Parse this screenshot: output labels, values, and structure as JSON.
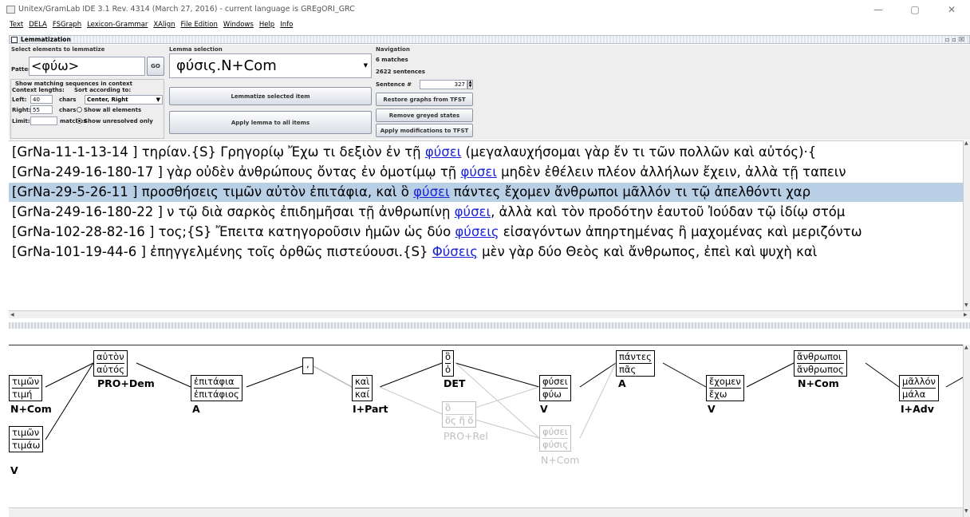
{
  "window": {
    "title": "Unitex/GramLab IDE 3.1  Rev. 4314 (March 27, 2016) - current language is GREgORI_GRC",
    "minimize": "—",
    "maximize": "▢",
    "close": "✕"
  },
  "menu": [
    "Text",
    "DELA",
    "FSGraph",
    "Lexicon-Grammar",
    "XAlign",
    "File Edition",
    "Windows",
    "Help",
    "Info"
  ],
  "frame": {
    "title": "Lemmatization"
  },
  "select_panel": {
    "title": "Select elements to lemmatize",
    "pattern_label": "Pattern:",
    "pattern_value": "<φύω>",
    "go_label": "GO",
    "context_title": "Show matching sequences in context",
    "context_lengths": "Context lengths:",
    "sort_label": "Sort according to:",
    "left_label": "Left:",
    "left_value": "40",
    "chars": "chars",
    "sort_value": "Center, Right",
    "right_label": "Right:",
    "right_value": "55",
    "show_all": "Show all elements",
    "limit_label": "Limit:",
    "limit_value": "",
    "matches": "matches",
    "show_unresolved": "Show unresolved only"
  },
  "lemma_panel": {
    "title": "Lemma selection",
    "selected": "φύσις.N+Com",
    "lemmatize_selected": "Lemmatize selected item",
    "apply_all": "Apply lemma to all items"
  },
  "nav_panel": {
    "title": "Navigation",
    "matches": "6 matches",
    "sentences": "2622 sentences",
    "sentence_label": "Sentence #",
    "sentence_value": "327",
    "restore": "Restore graphs from TFST",
    "remove": "Remove greyed states",
    "apply_mods": "Apply modifications to TFST"
  },
  "concordance": [
    {
      "pre": "[GrNa-11-1-13-14 ] τηρίαν.{S} Γρηγορίῳ Ἔχω τι δεξιὸν ἐν τῇ ",
      "match": "φύσει",
      "post": " (μεγαλαυχήσομαι γὰρ ἔν τι τῶν πολλῶν καὶ αὐτός)·{",
      "selected": false
    },
    {
      "pre": "[GrNa-249-16-180-17 ] γὰρ οὐδὲν ἀνθρώπους ὄντας ἐν ὁμοτίμῳ τῇ ",
      "match": "φύσει",
      "post": " μηδὲν ἐθέλειν πλέον ἀλλήλων ἔχειν, ἀλλὰ τῇ ταπειν",
      "selected": false
    },
    {
      "pre": "[GrNa-29-5-26-11 ]  προσθήσεις τιμῶν αὐτὸν ἐπιτάφια, καὶ ὃ ",
      "match": "φύσει",
      "post": " πάντες ἔχομεν ἄνθρωποι μᾶλλόν τι τῷ ἀπελθόντι χαρ",
      "selected": true
    },
    {
      "pre": "[GrNa-249-16-180-22 ] ν τῷ διὰ σαρκὸς ἐπιδημῆσαι τῇ ἀνθρωπίνῃ ",
      "match": "φύσει",
      "post": ", ἀλλὰ καὶ τὸν προδότην ἑαυτοῦ Ἰούδαν τῷ ἰδίῳ στόμ",
      "selected": false
    },
    {
      "pre": "[GrNa-102-28-82-16 ] τος;{S} Ἔπειτα κατηγοροῦσιν ἡμῶν ὡς δύο ",
      "match": "φύσεις",
      "post": " εἰσαγόντων ἀπηρτημένας ἢ μαχομένας καὶ μεριζόντω",
      "selected": false
    },
    {
      "pre": "[GrNa-101-19-44-6 ]  ἐπηγγελμένης τοῖς ὀρθῶς πιστεύουσι.{S} ",
      "match": "Φύσεις",
      "post": " μὲν γὰρ δύο Θεὸς καὶ ἄνθρωπος, ἐπεὶ καὶ ψυχὴ καὶ",
      "selected": false
    }
  ],
  "graph": {
    "nodes": [
      {
        "lines": [
          "τιμῶν",
          "τιμή"
        ],
        "label": "N+Com",
        "grey": false
      },
      {
        "lines": [
          "τιμῶν",
          "τιμάω"
        ],
        "label": "V",
        "grey": false
      },
      {
        "lines": [
          "αὐτὸν",
          "αὐτός"
        ],
        "label": "PRO+Dem",
        "grey": false
      },
      {
        "lines": [
          "ἐπιτάφια",
          "ἐπιτάφιος"
        ],
        "label": "A",
        "grey": false
      },
      {
        "lines": [
          ","
        ],
        "label": "",
        "grey": false
      },
      {
        "lines": [
          "καὶ",
          "καί"
        ],
        "label": "I+Part",
        "grey": false
      },
      {
        "lines": [
          "ὃ",
          "ὁ"
        ],
        "label": "DET",
        "grey": false
      },
      {
        "lines": [
          "ὃ",
          "ὅς ἥ ὅ"
        ],
        "label": "PRO+Rel",
        "grey": true
      },
      {
        "lines": [
          "φύσει",
          "φύω"
        ],
        "label": "V",
        "grey": false
      },
      {
        "lines": [
          "φύσει",
          "φύσις"
        ],
        "label": "N+Com",
        "grey": true
      },
      {
        "lines": [
          "πάντες",
          "πᾶς"
        ],
        "label": "A",
        "grey": false
      },
      {
        "lines": [
          "ἔχομεν",
          "ἔχω"
        ],
        "label": "V",
        "grey": false
      },
      {
        "lines": [
          "ἄνθρωποι",
          "ἄνθρωπος"
        ],
        "label": "N+Com",
        "grey": false
      },
      {
        "lines": [
          "μᾶλλόν",
          "μάλα"
        ],
        "label": "I+Adv",
        "grey": false
      }
    ]
  },
  "colors": {
    "match_link": "#1a22d6",
    "selected_row": "#b8cfe6",
    "panel_bg": "#eeeeee"
  }
}
